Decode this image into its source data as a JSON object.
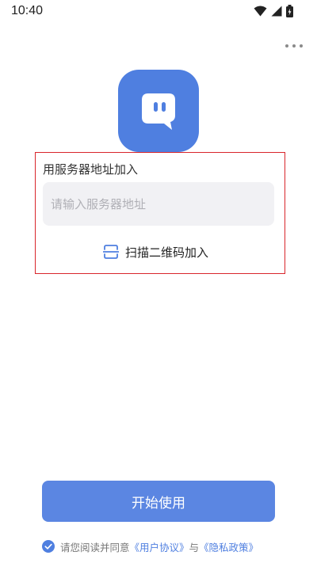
{
  "status_bar": {
    "time": "10:40",
    "icons": [
      "wifi-icon",
      "signal-icon",
      "battery-icon"
    ]
  },
  "toolbar": {
    "more_icon": "more-dots-icon"
  },
  "app": {
    "logo_icon": "chat-bubble-logo-icon",
    "brand_color": "#4f7fe0"
  },
  "join": {
    "server_label": "用服务器地址加入",
    "server_input_value": "",
    "server_input_placeholder": "请输入服务器地址",
    "scan_icon": "scan-icon",
    "scan_label": "扫描二维码加入"
  },
  "start_button_label": "开始使用",
  "agreement": {
    "checked": true,
    "prefix": "请您阅读并同意",
    "user_agreement": "《用户协议》",
    "conjunction": "与",
    "privacy_policy": "《隐私政策》"
  },
  "colors": {
    "accent": "#4f7fe0",
    "button": "#5b86e2",
    "highlight_border": "#d9252b",
    "input_bg": "#f1f1f4"
  }
}
